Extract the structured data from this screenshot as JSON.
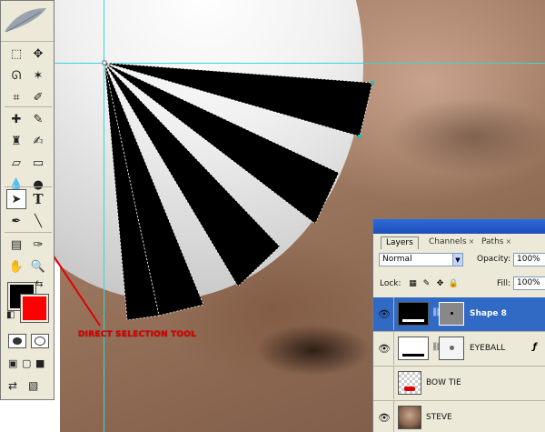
{
  "annotation": {
    "text": "DIRECT SELECTION TOOL"
  },
  "tools": {
    "foreground_color": "#000000",
    "background_color": "#ff0000",
    "active_tool": "direct-selection-tool"
  },
  "layers_panel": {
    "tabs": [
      {
        "label": "Layers",
        "active": true
      },
      {
        "label": "Channels",
        "active": false
      },
      {
        "label": "Paths",
        "active": false
      }
    ],
    "blend_mode": "Normal",
    "opacity_label": "Opacity:",
    "opacity_value": "100%",
    "lock_label": "Lock:",
    "fill_label": "Fill:",
    "fill_value": "100%",
    "layers": [
      {
        "name": "Shape 8",
        "selected": true,
        "has_mask": true,
        "visible": true
      },
      {
        "name": "EYEBALL",
        "selected": false,
        "has_mask": true,
        "has_effects": true,
        "visible": true
      },
      {
        "name": "BOW TIE",
        "selected": false,
        "has_mask": false,
        "visible": true
      },
      {
        "name": "STEVE",
        "selected": false,
        "has_mask": false,
        "visible": true
      }
    ]
  },
  "colors": {
    "guide": "#34d8d8",
    "selection_highlight": "#316ac5",
    "annotation_red": "#e00000",
    "panel_bg": "#ece9d8"
  }
}
